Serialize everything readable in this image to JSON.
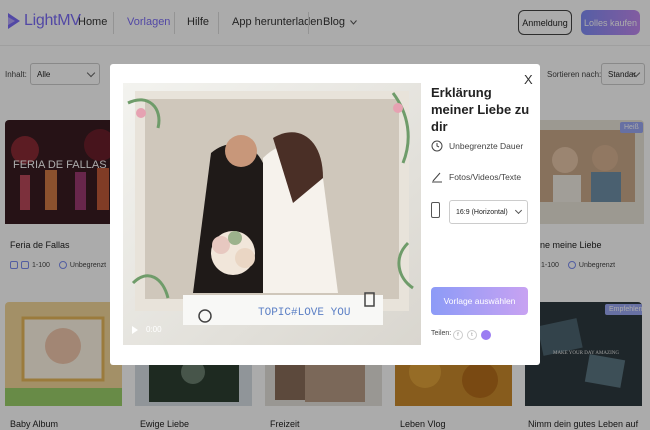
{
  "header": {
    "logo_text": "LightMV",
    "nav": {
      "home": "Home",
      "vorlagen": "Vorlagen",
      "hilfe": "Hilfe",
      "app": "App herunterladen",
      "blog": "Blog"
    },
    "login_label": "Anmeldung",
    "buy_label": "Lolles kaufen"
  },
  "filters": {
    "inhalt_label": "Inhalt:",
    "inhalt_value": "Alle",
    "sort_label": "Sortieren nach:",
    "sort_value": "Standar"
  },
  "cards": [
    {
      "title": "Feria de Fallas",
      "count": "1-100",
      "duration": "Unbegrenzt",
      "thumb_text": "FERIA DE FALLAS"
    },
    {
      "title": "Nenne meine Liebe",
      "title_visible": "enne meine Liebe",
      "count": "1-100",
      "duration": "Unbegrenzt",
      "badge": "Heiß"
    },
    {
      "title": "Baby Album"
    },
    {
      "title": "Ewige Liebe"
    },
    {
      "title": "Freizeit"
    },
    {
      "title": "Leben Vlog"
    },
    {
      "title": "Nimm dein gutes Leben auf",
      "badge": "Empfehlen",
      "thumb_text": "MAKE YOUR DAY AMAZING"
    }
  ],
  "modal": {
    "close": "X",
    "title": "Erklärung meiner Liebe zu dir",
    "feature_duration": "Unbegrenzte Dauer",
    "feature_media": "Fotos/Videos/Texte",
    "ratio_value": "16:9 (Horizontal)",
    "choose_label": "Vorlage auswählen",
    "share_label": "Teilen:",
    "video_time": "0:00",
    "video_caption": "TOPIC#LOVE YOU"
  },
  "colors": {
    "brand": "#7b6cf6",
    "overlay": "rgba(0,0,0,0.33)"
  }
}
